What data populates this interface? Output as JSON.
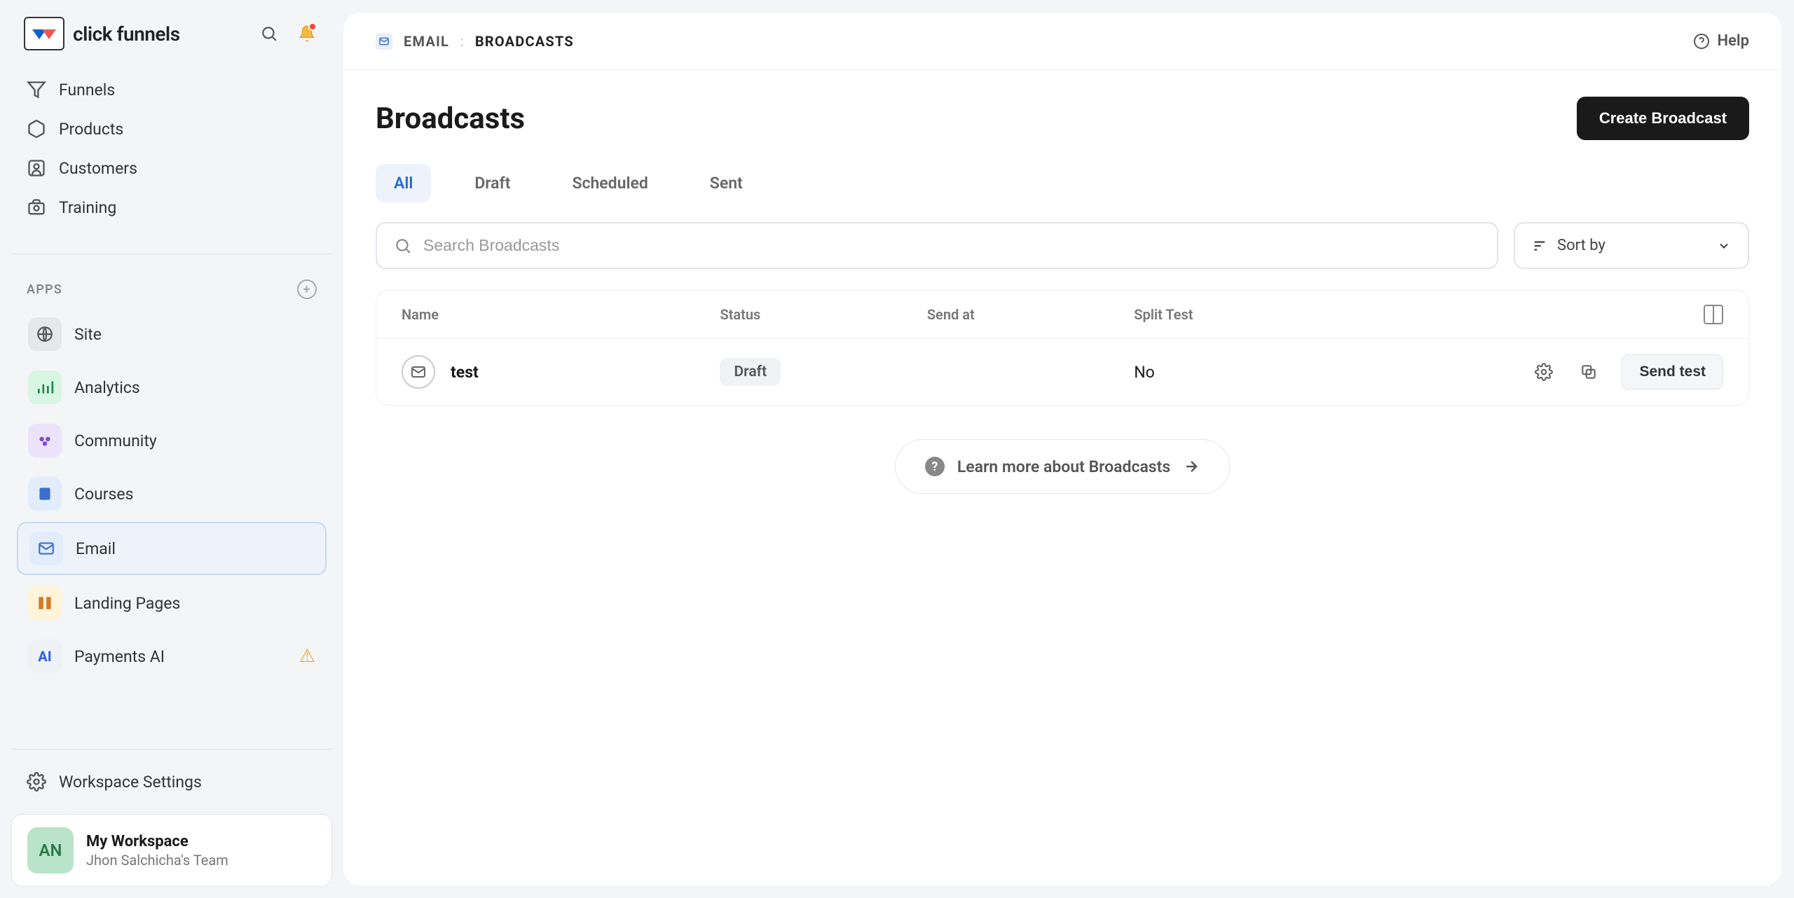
{
  "brand": "click funnels",
  "nav": [
    {
      "label": "Funnels"
    },
    {
      "label": "Products"
    },
    {
      "label": "Customers"
    },
    {
      "label": "Training"
    }
  ],
  "apps_header": "APPS",
  "apps": [
    {
      "label": "Site",
      "bg": "#e5e8eb",
      "fg": "#555"
    },
    {
      "label": "Analytics",
      "bg": "#d9f5e3",
      "fg": "#1f8a4c"
    },
    {
      "label": "Community",
      "bg": "#ece3fb",
      "fg": "#7a4fd1"
    },
    {
      "label": "Courses",
      "bg": "#e3ecfb",
      "fg": "#3a6fd1"
    },
    {
      "label": "Email",
      "bg": "#e3ecfb",
      "fg": "#3a6fd1",
      "active": true
    },
    {
      "label": "Landing Pages",
      "bg": "#fff4d9",
      "fg": "#d17a2a"
    },
    {
      "label": "Payments AI",
      "bg": "#eef1f5",
      "fg": "#3965d9",
      "warn": true
    }
  ],
  "workspace_settings": "Workspace Settings",
  "workspace": {
    "initials": "AN",
    "name": "My Workspace",
    "team": "Jhon Salchicha's Team"
  },
  "breadcrumb": {
    "parent": "EMAIL",
    "current": "BROADCASTS"
  },
  "help": "Help",
  "page_title": "Broadcasts",
  "create_button": "Create Broadcast",
  "tabs": [
    {
      "label": "All",
      "active": true
    },
    {
      "label": "Draft"
    },
    {
      "label": "Scheduled"
    },
    {
      "label": "Sent"
    }
  ],
  "search_placeholder": "Search Broadcasts",
  "sort_label": "Sort by",
  "columns": {
    "name": "Name",
    "status": "Status",
    "send_at": "Send at",
    "split_test": "Split Test"
  },
  "rows": [
    {
      "name": "test",
      "status": "Draft",
      "send_at": "",
      "split_test": "No",
      "send_test_label": "Send test"
    }
  ],
  "learn_more": "Learn more about Broadcasts"
}
